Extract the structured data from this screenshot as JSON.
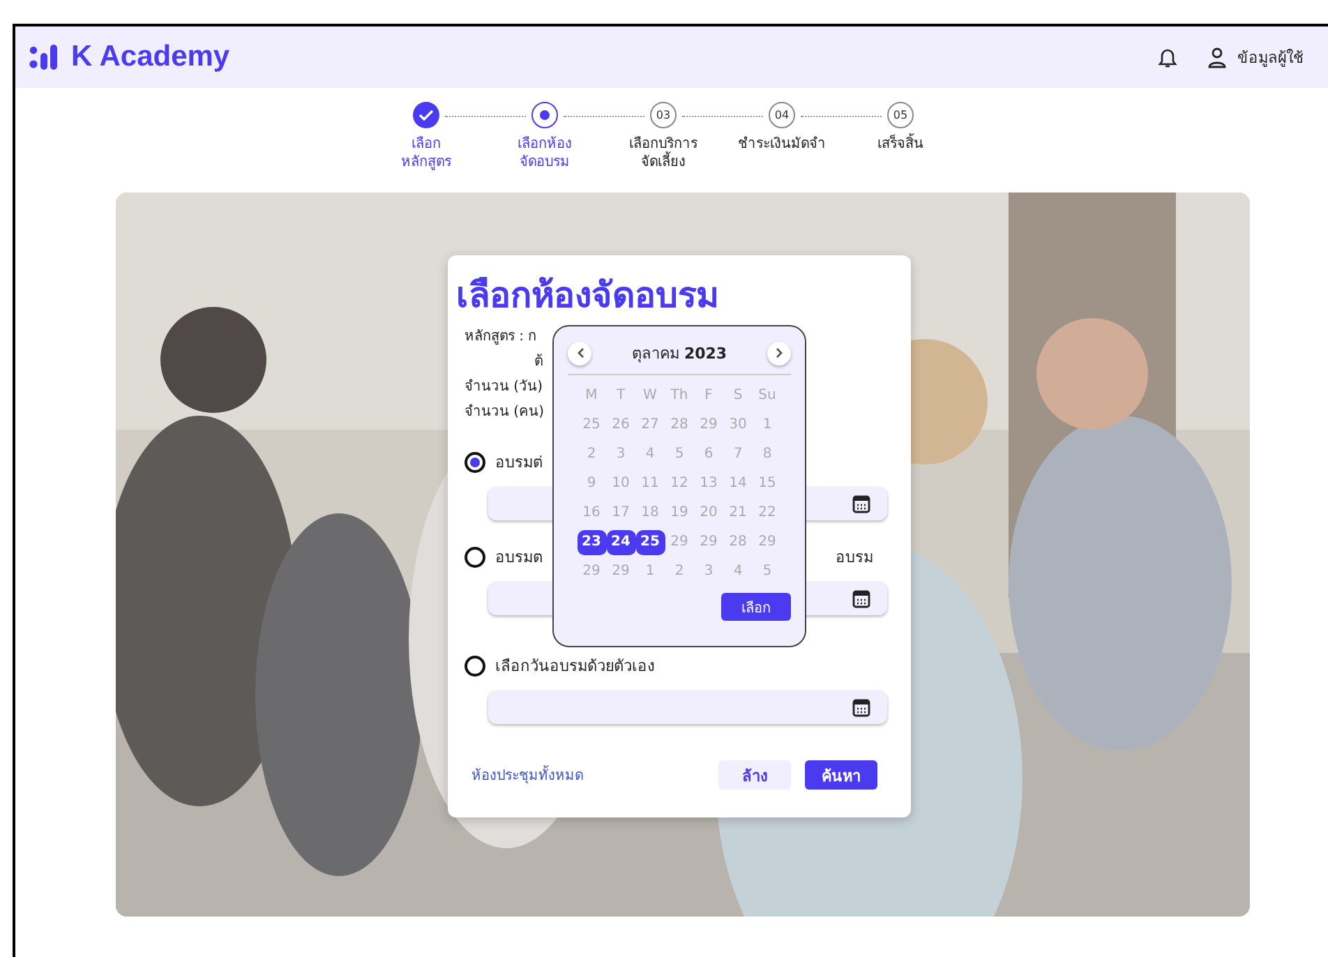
{
  "header": {
    "logo": "K Academy",
    "user_label": "ข้อมูลผู้ใช้"
  },
  "steps": [
    {
      "label": "เลือก\nหลักสูตร",
      "done": true,
      "current": false
    },
    {
      "label": "เลือกห้อง\nจัดอบรม",
      "done": false,
      "current": true
    },
    {
      "label": "เลือกบริการ\nจัดเลี้ยง",
      "done": false,
      "current": false,
      "number": "03"
    },
    {
      "label": "ชำระเงินมัดจำ",
      "done": false,
      "current": false,
      "number": "04"
    },
    {
      "label": "เสร็จสิ้น",
      "done": false,
      "current": false,
      "number": "05"
    }
  ],
  "dialog": {
    "title": "เลือกห้องจัดอบรม",
    "info_lines": [
      "หลักสูตร : ก",
      "ต้",
      "จำนวน (วัน)",
      "จำนวน (คน)"
    ],
    "options": [
      {
        "label": "อบรมต่",
        "selected": true
      },
      {
        "label": "อบรมต",
        "label_end": "อบรม",
        "selected": false
      },
      {
        "label": "เลือกวันอบรมด้วยตัวเอง",
        "selected": false
      }
    ],
    "link": "ห้องประชุมทั้งหมด",
    "buttons": [
      {
        "label": "ล้าง",
        "kind": "secondary"
      },
      {
        "label": "ค้นหา",
        "kind": "primary"
      }
    ]
  },
  "calendar": {
    "month": "ตุลาคม",
    "year": "2023",
    "weekdays": [
      "M",
      "T",
      "W",
      "Th",
      "F",
      "S",
      "Su"
    ],
    "weeks": [
      [
        {
          "d": "25",
          "selected": false
        },
        {
          "d": "26",
          "selected": false
        },
        {
          "d": "27",
          "selected": false
        },
        {
          "d": "28",
          "selected": false
        },
        {
          "d": "29",
          "selected": false
        },
        {
          "d": "30",
          "selected": false
        },
        {
          "d": "1",
          "selected": false
        }
      ],
      [
        {
          "d": "2",
          "selected": false
        },
        {
          "d": "3",
          "selected": false
        },
        {
          "d": "4",
          "selected": false
        },
        {
          "d": "5",
          "selected": false
        },
        {
          "d": "6",
          "selected": false
        },
        {
          "d": "7",
          "selected": false
        },
        {
          "d": "8",
          "selected": false
        }
      ],
      [
        {
          "d": "9",
          "selected": false
        },
        {
          "d": "10",
          "selected": false
        },
        {
          "d": "11",
          "selected": false
        },
        {
          "d": "12",
          "selected": false
        },
        {
          "d": "13",
          "selected": false
        },
        {
          "d": "14",
          "selected": false
        },
        {
          "d": "15",
          "selected": false
        }
      ],
      [
        {
          "d": "16",
          "selected": false
        },
        {
          "d": "17",
          "selected": false
        },
        {
          "d": "18",
          "selected": false
        },
        {
          "d": "19",
          "selected": false
        },
        {
          "d": "20",
          "selected": false
        },
        {
          "d": "21",
          "selected": false
        },
        {
          "d": "22",
          "selected": false
        }
      ],
      [
        {
          "d": "23",
          "selected": true
        },
        {
          "d": "24",
          "selected": true
        },
        {
          "d": "25",
          "selected": true
        },
        {
          "d": "29",
          "selected": false
        },
        {
          "d": "29",
          "selected": false
        },
        {
          "d": "28",
          "selected": false
        },
        {
          "d": "29",
          "selected": false
        }
      ],
      [
        {
          "d": "29",
          "selected": false
        },
        {
          "d": "29",
          "selected": false
        },
        {
          "d": "1",
          "selected": false
        },
        {
          "d": "2",
          "selected": false
        },
        {
          "d": "3",
          "selected": false
        },
        {
          "d": "4",
          "selected": false
        },
        {
          "d": "5",
          "selected": false
        }
      ]
    ],
    "confirm": "เลือก"
  }
}
